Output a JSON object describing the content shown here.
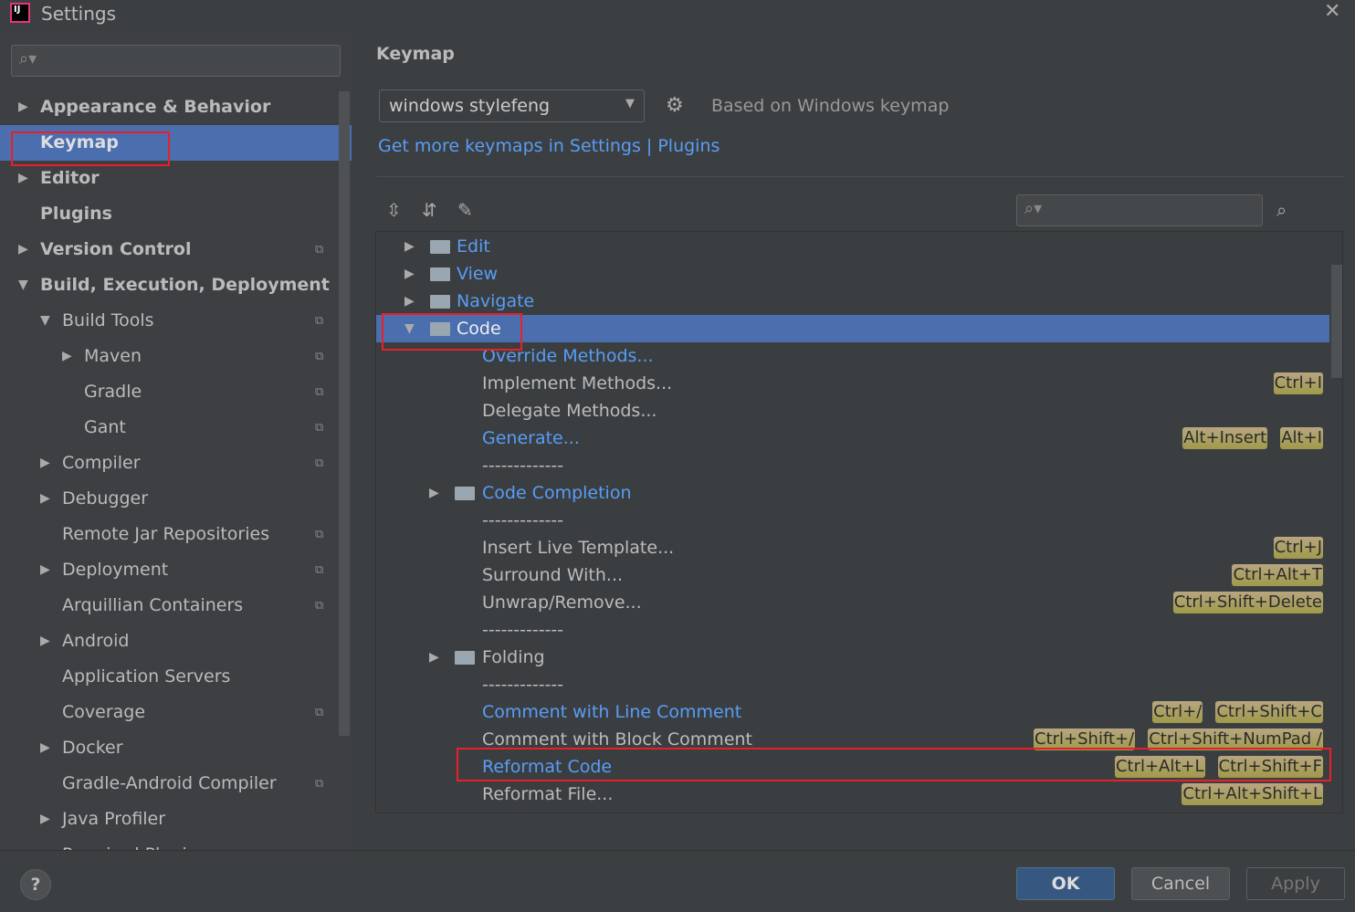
{
  "window": {
    "title": "Settings",
    "close_icon": "close-icon"
  },
  "sidebar": {
    "search_placeholder": "",
    "items": [
      {
        "label": "Appearance & Behavior",
        "level": 0,
        "arrow": "right",
        "bold": true
      },
      {
        "label": "Keymap",
        "level": 0,
        "arrow": "",
        "bold": true,
        "selected": true
      },
      {
        "label": "Editor",
        "level": 0,
        "arrow": "right",
        "bold": true
      },
      {
        "label": "Plugins",
        "level": 0,
        "arrow": "",
        "bold": true
      },
      {
        "label": "Version Control",
        "level": 0,
        "arrow": "right",
        "bold": true,
        "cfg": true
      },
      {
        "label": "Build, Execution, Deployment",
        "level": 0,
        "arrow": "down",
        "bold": true
      },
      {
        "label": "Build Tools",
        "level": 1,
        "arrow": "down",
        "cfg": true
      },
      {
        "label": "Maven",
        "level": 2,
        "arrow": "right",
        "cfg": true
      },
      {
        "label": "Gradle",
        "level": 2,
        "arrow": "",
        "cfg": true
      },
      {
        "label": "Gant",
        "level": 2,
        "arrow": "",
        "cfg": true
      },
      {
        "label": "Compiler",
        "level": 1,
        "arrow": "right",
        "cfg": true
      },
      {
        "label": "Debugger",
        "level": 1,
        "arrow": "right"
      },
      {
        "label": "Remote Jar Repositories",
        "level": 1,
        "arrow": "",
        "cfg": true
      },
      {
        "label": "Deployment",
        "level": 1,
        "arrow": "right",
        "cfg": true
      },
      {
        "label": "Arquillian Containers",
        "level": 1,
        "arrow": "",
        "cfg": true
      },
      {
        "label": "Android",
        "level": 1,
        "arrow": "right"
      },
      {
        "label": "Application Servers",
        "level": 1,
        "arrow": ""
      },
      {
        "label": "Coverage",
        "level": 1,
        "arrow": "",
        "cfg": true
      },
      {
        "label": "Docker",
        "level": 1,
        "arrow": "right"
      },
      {
        "label": "Gradle-Android Compiler",
        "level": 1,
        "arrow": "",
        "cfg": true
      },
      {
        "label": "Java Profiler",
        "level": 1,
        "arrow": "right"
      },
      {
        "label": "Required Plugins",
        "level": 1,
        "arrow": "",
        "cfg": true
      }
    ]
  },
  "main": {
    "heading": "Keymap",
    "keymap_value": "windows stylefeng",
    "based_on": "Based on Windows keymap",
    "link": "Get more keymaps in Settings | Plugins",
    "search_placeholder": "",
    "toolbar_icons": [
      "expand-all-icon",
      "collapse-all-icon",
      "edit-icon"
    ],
    "tree": [
      {
        "label": "Edit",
        "level": 0,
        "arrow": "right",
        "folder": true,
        "blue": true,
        "keys": []
      },
      {
        "label": "View",
        "level": 0,
        "arrow": "right",
        "folder": true,
        "blue": true,
        "keys": []
      },
      {
        "label": "Navigate",
        "level": 0,
        "arrow": "right",
        "folder": true,
        "blue": true,
        "keys": []
      },
      {
        "label": "Code",
        "level": 0,
        "arrow": "down",
        "folder": true,
        "selected": true,
        "keys": []
      },
      {
        "label": "Override Methods...",
        "level": 1,
        "blue": true,
        "keys": []
      },
      {
        "label": "Implement Methods...",
        "level": 1,
        "keys": [
          "Ctrl+I"
        ]
      },
      {
        "label": "Delegate Methods...",
        "level": 1,
        "keys": []
      },
      {
        "label": "Generate...",
        "level": 1,
        "blue": true,
        "keys": [
          "Alt+Insert",
          "Alt+I"
        ]
      },
      {
        "label": "-------------",
        "level": 1,
        "keys": []
      },
      {
        "label": "Code Completion",
        "level": 1,
        "arrow": "right",
        "folder": true,
        "blue": true,
        "keys": []
      },
      {
        "label": "-------------",
        "level": 1,
        "keys": []
      },
      {
        "label": "Insert Live Template...",
        "level": 1,
        "keys": [
          "Ctrl+J"
        ]
      },
      {
        "label": "Surround With...",
        "level": 1,
        "keys": [
          "Ctrl+Alt+T"
        ]
      },
      {
        "label": "Unwrap/Remove...",
        "level": 1,
        "keys": [
          "Ctrl+Shift+Delete"
        ]
      },
      {
        "label": "-------------",
        "level": 1,
        "keys": []
      },
      {
        "label": "Folding",
        "level": 1,
        "arrow": "right",
        "folder": true,
        "keys": []
      },
      {
        "label": "-------------",
        "level": 1,
        "keys": []
      },
      {
        "label": "Comment with Line Comment",
        "level": 1,
        "blue": true,
        "keys": [
          "Ctrl+/",
          "Ctrl+Shift+C"
        ]
      },
      {
        "label": "Comment with Block Comment",
        "level": 1,
        "keys": [
          "Ctrl+Shift+/",
          "Ctrl+Shift+NumPad /"
        ]
      },
      {
        "label": "Reformat Code",
        "level": 1,
        "blue": true,
        "keys": [
          "Ctrl+Alt+L",
          "Ctrl+Shift+F"
        ]
      },
      {
        "label": "Reformat File...",
        "level": 1,
        "keys": [
          "Ctrl+Alt+Shift+L"
        ]
      }
    ]
  },
  "footer": {
    "help": "?",
    "ok": "OK",
    "cancel": "Cancel",
    "apply": "Apply"
  },
  "colors": {
    "selection": "#4b6eaf",
    "link": "#589df6",
    "shortcut_badge": "#a09a4a",
    "highlight_box": "#e8202a"
  }
}
